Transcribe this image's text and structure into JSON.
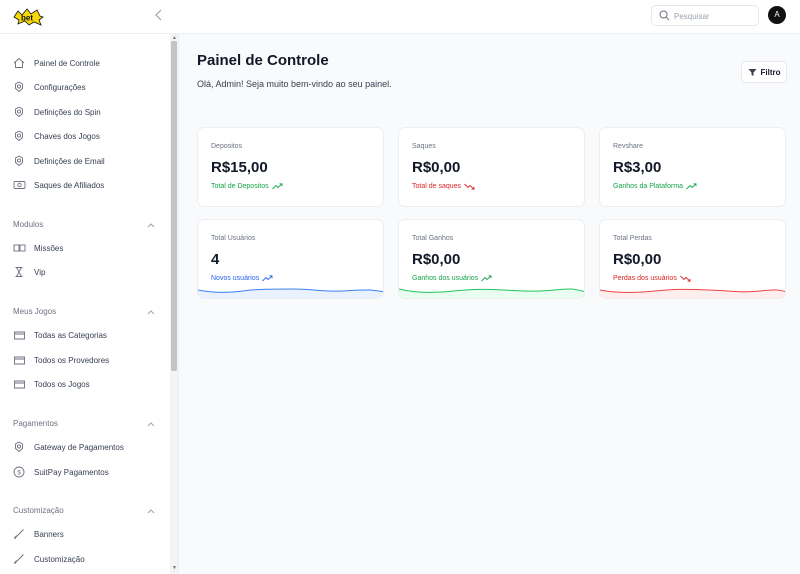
{
  "header": {
    "logo_text": "bet",
    "search_placeholder": "Pesquisar",
    "avatar_initial": "A"
  },
  "sidebar": {
    "items": [
      {
        "label": "Painel de Controle",
        "icon": "home-icon"
      },
      {
        "label": "Configurações",
        "icon": "gear-icon"
      },
      {
        "label": "Definições do Spin",
        "icon": "gear-icon"
      },
      {
        "label": "Chaves dos Jogos",
        "icon": "gear-icon"
      },
      {
        "label": "Definições de Email",
        "icon": "gear-icon"
      },
      {
        "label": "Saques de Afiliados",
        "icon": "banknote-icon"
      }
    ],
    "sections": [
      {
        "title": "Modulos",
        "items": [
          {
            "label": "Missões",
            "icon": "cards-icon"
          },
          {
            "label": "Vip",
            "icon": "hourglass-icon"
          }
        ]
      },
      {
        "title": "Meus Jogos",
        "items": [
          {
            "label": "Todas as Categorias",
            "icon": "folder-icon"
          },
          {
            "label": "Todos os Provedores",
            "icon": "folder-icon"
          },
          {
            "label": "Todos os Jogos",
            "icon": "folder-icon"
          }
        ]
      },
      {
        "title": "Pagamentos",
        "items": [
          {
            "label": "Gateway de Pagamentos",
            "icon": "gear-icon"
          },
          {
            "label": "SuitPay Pagamentos",
            "icon": "dollar-circle-icon"
          }
        ]
      },
      {
        "title": "Customização",
        "items": [
          {
            "label": "Banners",
            "icon": "brush-icon"
          },
          {
            "label": "Customização",
            "icon": "brush-icon"
          }
        ]
      }
    ]
  },
  "main": {
    "title": "Painel de Controle",
    "subtitle": "Olá, Admin! Seja muito bem-vindo ao seu painel.",
    "filter_label": "Filtro",
    "stats": [
      {
        "label": "Depositos",
        "value": "R$15,00",
        "note": "Total de Depositos",
        "trend": "up"
      },
      {
        "label": "Saques",
        "value": "R$0,00",
        "note": "Total de saques",
        "trend": "down"
      },
      {
        "label": "Revshare",
        "value": "R$3,00",
        "note": "Ganhos da Plataforma",
        "trend": "up"
      },
      {
        "label": "Total Usuários",
        "value": "4",
        "note": "Novos usuários",
        "trend": "up"
      },
      {
        "label": "Total Ganhos",
        "value": "R$0,00",
        "note": "Ganhos dos usuários",
        "trend": "up"
      },
      {
        "label": "Total Perdas",
        "value": "R$0,00",
        "note": "Perdas dos usuários",
        "trend": "down"
      }
    ]
  },
  "colors": {
    "up": "#16a34a",
    "down": "#dc2626",
    "users_note": "#2563eb",
    "wave_blue": "#3b82f6",
    "wave_green": "#22c55e",
    "wave_red": "#ef4444"
  }
}
